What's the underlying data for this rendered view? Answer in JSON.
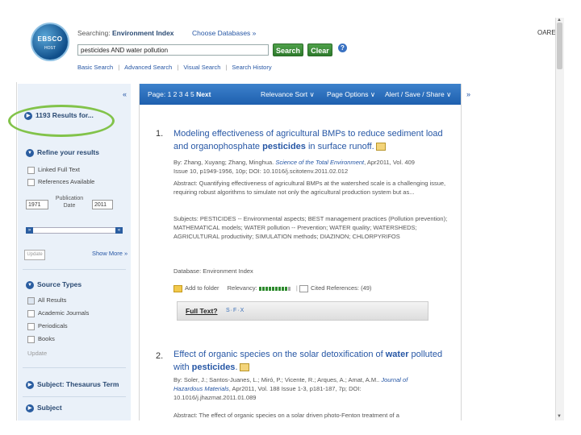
{
  "header": {
    "logo_text": "EBSCO",
    "logo_sub": "HOST",
    "searching_label": "Searching:",
    "database": "Environment Index",
    "choose_databases": "Choose Databases »",
    "query": "pesticides AND water pollution",
    "search_button": "Search",
    "clear_button": "Clear",
    "help": "?",
    "links": [
      "Basic Search",
      "Advanced Search",
      "Visual Search",
      "Search History"
    ],
    "top_right": "OARE"
  },
  "sidebar": {
    "collapse": "«",
    "results": "1193 Results for...",
    "refine_heading": "Refine your results",
    "limiters": [
      "Linked Full Text",
      "References Available"
    ],
    "date_from": "1971",
    "date_to": "2011",
    "date_label": "Publication Date",
    "update": "Update",
    "show_more": "Show More »",
    "source_types_heading": "Source Types",
    "source_types": [
      "All Results",
      "Academic Journals",
      "Periodicals",
      "Books"
    ],
    "source_update": "Update",
    "thesaurus": "Subject: Thesaurus Term",
    "subject": "Subject"
  },
  "toolbar": {
    "page_label": "Page:",
    "pages": "1 2 3 4 5",
    "next": "Next",
    "sort": "Relevance Sort ∨",
    "options": "Page Options ∨",
    "alert": "Alert / Save / Share ∨",
    "expand": "»"
  },
  "results": [
    {
      "number": "1.",
      "title_line1": "Modeling effectiveness of agricultural BMPs to reduce sediment load",
      "title_line2_pre": "and organophosphate ",
      "title_line2_bold": "pesticides",
      "title_line2_post": " in surface runoff.",
      "meta_line1_pre": "By: Zhang, Xuyang; Zhang, Minghua. ",
      "meta_line1_journal": "Science of the Total Environment",
      "meta_line1_post": ", Apr2011, Vol. 409",
      "meta_line2": "Issue 10, p1949-1956, 10p; DOI: 10.1016/j.scitotenv.2011.02.012",
      "abstract": "Abstract: Quantifying effectiveness of agricultural BMPs at the watershed scale is a challenging issue, requiring robust algorithms to simulate not only the agricultural production system but as...",
      "subjects": "Subjects: PESTICIDES -- Environmental aspects; BEST management practices (Pollution prevention); MATHEMATICAL models; WATER pollution -- Prevention; WATER quality; WATERSHEDS; AGRICULTURAL productivity; SIMULATION methods; DIAZINON; CHLORPYRIFOS",
      "database": "Database: Environment Index",
      "add_to_folder": "Add to folder",
      "relevancy": "Relevancy:",
      "cited": "Cited References: (49)",
      "full_text": "Full Text?",
      "sfx": "S·F·X"
    },
    {
      "number": "2.",
      "title_line1_pre": "Effect of organic species on the solar detoxification of ",
      "title_line1_bold": "water",
      "title_line1_post": " polluted",
      "title_line2_pre": "with ",
      "title_line2_bold": "pesticides",
      "title_line2_post": ".",
      "meta_line1_pre": "By: Soler, J.; Santos-Juanes, L.; Miró, P.; Vicente, R.; Arques, A.; Amat, A.M.. ",
      "meta_line1_journal": "Journal of",
      "meta_line2_journal": "Hazardous Materials",
      "meta_line2_post": ", Apr2011, Vol. 188 Issue 1-3, p181-187, 7p; DOI:",
      "meta_line3": "10.1016/j.jhazmat.2011.01.089",
      "abstract": "Abstract: The effect of organic species on a solar driven photo-Fenton treatment of a"
    }
  ]
}
